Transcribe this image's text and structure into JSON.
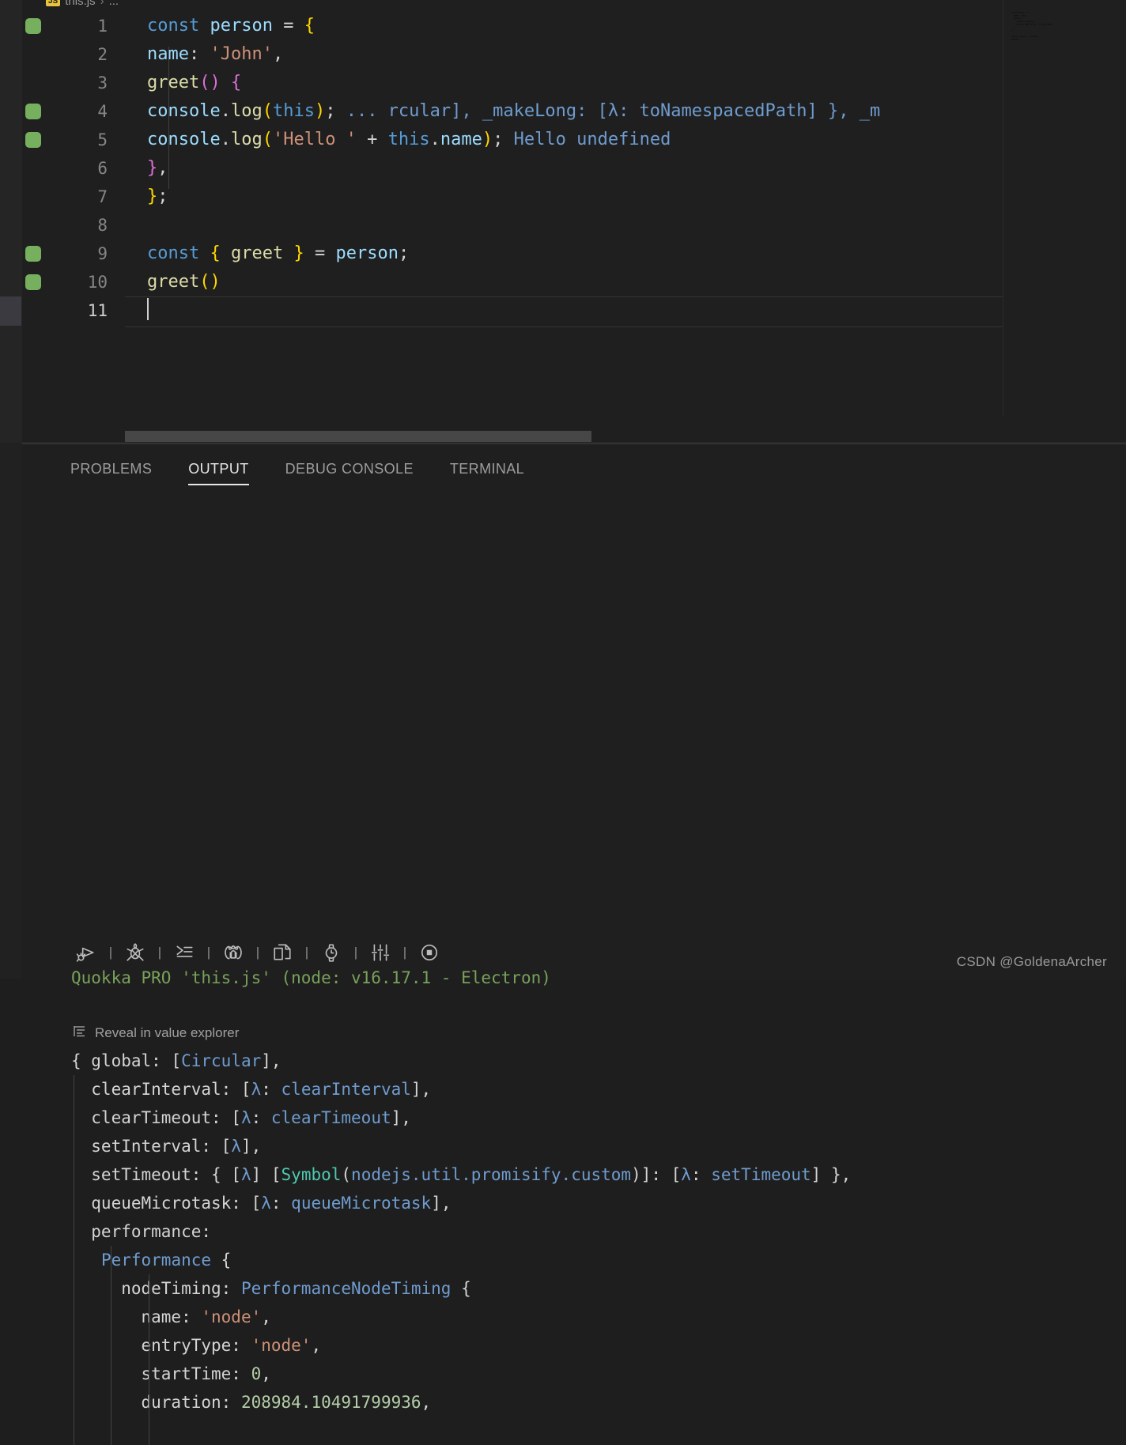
{
  "breadcrumb": {
    "badge": "JS",
    "file": "this.js",
    "separator": "›",
    "tail": "..."
  },
  "editor": {
    "lines": [
      {
        "num": "1",
        "marker": true,
        "tokens": [
          {
            "t": "const",
            "c": "t-kw"
          },
          {
            "t": " ",
            "c": "t-op"
          },
          {
            "t": "person",
            "c": "t-var"
          },
          {
            "t": " ",
            "c": "t-op"
          },
          {
            "t": "=",
            "c": "t-op"
          },
          {
            "t": " ",
            "c": "t-op"
          },
          {
            "t": "{",
            "c": "t-br-y"
          }
        ]
      },
      {
        "num": "2",
        "marker": false,
        "tokens": [
          {
            "t": "  ",
            "c": "t-op"
          },
          {
            "t": "name",
            "c": "t-var"
          },
          {
            "t": ": ",
            "c": "t-op"
          },
          {
            "t": "'John'",
            "c": "t-str"
          },
          {
            "t": ",",
            "c": "t-op"
          }
        ]
      },
      {
        "num": "3",
        "marker": false,
        "tokens": [
          {
            "t": "  ",
            "c": "t-op"
          },
          {
            "t": "greet",
            "c": "t-fn"
          },
          {
            "t": "()",
            "c": "t-br-p"
          },
          {
            "t": " ",
            "c": "t-op"
          },
          {
            "t": "{",
            "c": "t-br-p"
          }
        ]
      },
      {
        "num": "4",
        "marker": true,
        "tokens": [
          {
            "t": "    ",
            "c": "t-op"
          },
          {
            "t": "console",
            "c": "t-var"
          },
          {
            "t": ".",
            "c": "t-op"
          },
          {
            "t": "log",
            "c": "t-fn"
          },
          {
            "t": "(",
            "c": "t-br-y"
          },
          {
            "t": "this",
            "c": "t-kw"
          },
          {
            "t": ")",
            "c": "t-br-y"
          },
          {
            "t": ";",
            "c": "t-op"
          },
          {
            "t": "  ",
            "c": "t-op"
          },
          {
            "t": "... rcular], _makeLong: [λ: toNamespacedPath] }, _m",
            "c": "t-out"
          }
        ]
      },
      {
        "num": "5",
        "marker": true,
        "tokens": [
          {
            "t": "    ",
            "c": "t-op"
          },
          {
            "t": "console",
            "c": "t-var"
          },
          {
            "t": ".",
            "c": "t-op"
          },
          {
            "t": "log",
            "c": "t-fn"
          },
          {
            "t": "(",
            "c": "t-br-y"
          },
          {
            "t": "'Hello '",
            "c": "t-str"
          },
          {
            "t": " + ",
            "c": "t-op"
          },
          {
            "t": "this",
            "c": "t-kw"
          },
          {
            "t": ".",
            "c": "t-op"
          },
          {
            "t": "name",
            "c": "t-var"
          },
          {
            "t": ")",
            "c": "t-br-y"
          },
          {
            "t": ";",
            "c": "t-op"
          },
          {
            "t": "  ",
            "c": "t-op"
          },
          {
            "t": "Hello undefined",
            "c": "t-out"
          }
        ]
      },
      {
        "num": "6",
        "marker": false,
        "tokens": [
          {
            "t": "  ",
            "c": "t-op"
          },
          {
            "t": "}",
            "c": "t-br-p"
          },
          {
            "t": ",",
            "c": "t-op"
          }
        ]
      },
      {
        "num": "7",
        "marker": false,
        "tokens": [
          {
            "t": "}",
            "c": "t-br-y"
          },
          {
            "t": ";",
            "c": "t-op"
          }
        ]
      },
      {
        "num": "8",
        "marker": false,
        "tokens": []
      },
      {
        "num": "9",
        "marker": true,
        "tokens": [
          {
            "t": "const",
            "c": "t-kw"
          },
          {
            "t": " ",
            "c": "t-op"
          },
          {
            "t": "{",
            "c": "t-br-y"
          },
          {
            "t": " ",
            "c": "t-op"
          },
          {
            "t": "greet",
            "c": "t-fn"
          },
          {
            "t": " ",
            "c": "t-op"
          },
          {
            "t": "}",
            "c": "t-br-y"
          },
          {
            "t": " ",
            "c": "t-op"
          },
          {
            "t": "=",
            "c": "t-op"
          },
          {
            "t": " ",
            "c": "t-op"
          },
          {
            "t": "person",
            "c": "t-var"
          },
          {
            "t": ";",
            "c": "t-op"
          }
        ]
      },
      {
        "num": "10",
        "marker": true,
        "tokens": [
          {
            "t": "greet",
            "c": "t-fn"
          },
          {
            "t": "()",
            "c": "t-br-y"
          }
        ]
      },
      {
        "num": "11",
        "marker": false,
        "active": true,
        "tokens": []
      }
    ]
  },
  "minimap": {
    "text": "const person = {\n  name: 'John',\n  greet() {\n    console.log(this);\n    console.log('Hello ' + this.name);\n  },\n};\n\nconst { greet } = person;\ngreet()"
  },
  "panel": {
    "tabs": [
      {
        "label": "PROBLEMS",
        "active": false,
        "name": "tab-problems"
      },
      {
        "label": "OUTPUT",
        "active": true,
        "name": "tab-output"
      },
      {
        "label": "DEBUG CONSOLE",
        "active": false,
        "name": "tab-debug-console"
      },
      {
        "label": "TERMINAL",
        "active": false,
        "name": "tab-terminal"
      }
    ],
    "toolbar": {
      "separator": "|",
      "icons": [
        "start-quokka-icon",
        "stop-quokka-icon",
        "run-to-line-icon",
        "community-icon",
        "copy-icon",
        "timing-icon",
        "settings-sliders-icon",
        "record-stop-icon"
      ]
    },
    "quokka_header": "Quokka PRO 'this.js' (node: v16.17.1 - Electron)",
    "reveal_link": "Reveal in value explorer",
    "output_lines": [
      {
        "indent": 0,
        "tokens": [
          {
            "t": "{ ",
            "c": "t-op"
          },
          {
            "t": "global",
            "c": "t-op"
          },
          {
            "t": ": ",
            "c": "t-op"
          },
          {
            "t": "[",
            "c": "t-op"
          },
          {
            "t": "Circular",
            "c": "t-out"
          },
          {
            "t": "],",
            "c": "t-op"
          }
        ]
      },
      {
        "indent": 1,
        "tokens": [
          {
            "t": "  clearInterval: [",
            "c": "t-op"
          },
          {
            "t": "λ",
            "c": "t-out"
          },
          {
            "t": ": ",
            "c": "t-op"
          },
          {
            "t": "clearInterval",
            "c": "t-out"
          },
          {
            "t": "],",
            "c": "t-op"
          }
        ]
      },
      {
        "indent": 1,
        "tokens": [
          {
            "t": "  clearTimeout: [",
            "c": "t-op"
          },
          {
            "t": "λ",
            "c": "t-out"
          },
          {
            "t": ": ",
            "c": "t-op"
          },
          {
            "t": "clearTimeout",
            "c": "t-out"
          },
          {
            "t": "],",
            "c": "t-op"
          }
        ]
      },
      {
        "indent": 1,
        "tokens": [
          {
            "t": "  setInterval: [",
            "c": "t-op"
          },
          {
            "t": "λ",
            "c": "t-out"
          },
          {
            "t": "],",
            "c": "t-op"
          }
        ]
      },
      {
        "indent": 1,
        "tokens": [
          {
            "t": "  setTimeout: { [",
            "c": "t-op"
          },
          {
            "t": "λ",
            "c": "t-out"
          },
          {
            "t": "] [",
            "c": "t-op"
          },
          {
            "t": "Symbol",
            "c": "t-cls"
          },
          {
            "t": "(",
            "c": "t-op"
          },
          {
            "t": "nodejs.util.promisify.custom",
            "c": "t-out"
          },
          {
            "t": ")]: [",
            "c": "t-op"
          },
          {
            "t": "λ",
            "c": "t-out"
          },
          {
            "t": ": ",
            "c": "t-op"
          },
          {
            "t": "setTimeout",
            "c": "t-out"
          },
          {
            "t": "] },",
            "c": "t-op"
          }
        ]
      },
      {
        "indent": 1,
        "tokens": [
          {
            "t": "  queueMicrotask: [",
            "c": "t-op"
          },
          {
            "t": "λ",
            "c": "t-out"
          },
          {
            "t": ": ",
            "c": "t-op"
          },
          {
            "t": "queueMicrotask",
            "c": "t-out"
          },
          {
            "t": "],",
            "c": "t-op"
          }
        ]
      },
      {
        "indent": 1,
        "tokens": [
          {
            "t": "  performance:",
            "c": "t-op"
          }
        ]
      },
      {
        "indent": 2,
        "tokens": [
          {
            "t": "   ",
            "c": "t-op"
          },
          {
            "t": "Performance",
            "c": "t-out"
          },
          {
            "t": " {",
            "c": "t-op"
          }
        ]
      },
      {
        "indent": 3,
        "tokens": [
          {
            "t": "     nodeTiming: ",
            "c": "t-op"
          },
          {
            "t": "PerformanceNodeTiming",
            "c": "t-out"
          },
          {
            "t": " {",
            "c": "t-op"
          }
        ]
      },
      {
        "indent": 3,
        "tokens": [
          {
            "t": "       name: ",
            "c": "t-op"
          },
          {
            "t": "'node'",
            "c": "t-str"
          },
          {
            "t": ",",
            "c": "t-op"
          }
        ]
      },
      {
        "indent": 3,
        "tokens": [
          {
            "t": "       entryType: ",
            "c": "t-op"
          },
          {
            "t": "'node'",
            "c": "t-str"
          },
          {
            "t": ",",
            "c": "t-op"
          }
        ]
      },
      {
        "indent": 3,
        "tokens": [
          {
            "t": "       startTime: ",
            "c": "t-op"
          },
          {
            "t": "0",
            "c": "t-num"
          },
          {
            "t": ",",
            "c": "t-op"
          }
        ]
      },
      {
        "indent": 3,
        "tokens": [
          {
            "t": "       duration: ",
            "c": "t-op"
          },
          {
            "t": "208984.10491799936",
            "c": "t-num"
          },
          {
            "t": ",",
            "c": "t-op"
          }
        ]
      }
    ]
  },
  "watermark": "CSDN @GoldenaArcher",
  "colors": {
    "editor_bg": "#1f1f1f",
    "panel_bg": "#1f1f1f",
    "marker_green": "#76b05e",
    "quokka_green": "#78a15b",
    "keyword_blue": "#569cd6",
    "variable_blue": "#9cdcfe",
    "function_yellow": "#dcdcaa",
    "string_orange": "#ce9178",
    "bracket_yellow": "#ffd700",
    "bracket_pink": "#da70d6",
    "output_blue": "#6f9ccf",
    "number_green": "#b5cea8",
    "class_teal": "#4ec9b0"
  }
}
